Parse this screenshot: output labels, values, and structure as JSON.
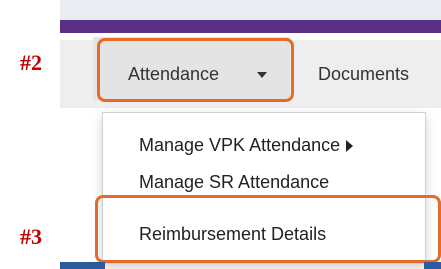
{
  "steps": {
    "step2": "#2",
    "step3": "#3"
  },
  "nav": {
    "attendance_label": "Attendance",
    "documents_label": "Documents"
  },
  "menu": {
    "items": [
      {
        "label": "Manage VPK Attendance"
      },
      {
        "label": "Manage SR Attendance"
      },
      {
        "label": "Reimbursement Details"
      }
    ]
  },
  "colors": {
    "highlight": "#e46c29",
    "step_label": "#c00000",
    "header_bar": "#5b2f86"
  }
}
